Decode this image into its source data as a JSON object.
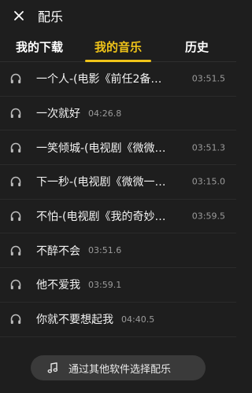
{
  "header": {
    "title": "配乐"
  },
  "tabs": [
    {
      "label": "我的下载"
    },
    {
      "label": "我的音乐"
    },
    {
      "label": "历史"
    }
  ],
  "songs": [
    {
      "title": "一个人-(电影《前任2备…",
      "duration": "03:51.5"
    },
    {
      "title": "一次就好",
      "duration": "04:26.8"
    },
    {
      "title": "一笑倾城-(电视剧《微微…",
      "duration": "03:51.3"
    },
    {
      "title": "下一秒-(电视剧《微微一…",
      "duration": "03:15.0"
    },
    {
      "title": "不怕-(电视剧《我的奇妙…",
      "duration": "03:59.5"
    },
    {
      "title": "不醉不会",
      "duration": "03:51.6"
    },
    {
      "title": "他不爱我",
      "duration": "03:59.1"
    },
    {
      "title": "你就不要想起我",
      "duration": "04:40.5"
    }
  ],
  "bottom_button": {
    "label": "通过其他软件选择配乐"
  },
  "icons": {
    "row": "headphones-icon",
    "close": "close-icon",
    "bottom": "music-note-icon"
  },
  "colors": {
    "accent": "#f0c419",
    "background": "#1e1e1e"
  }
}
